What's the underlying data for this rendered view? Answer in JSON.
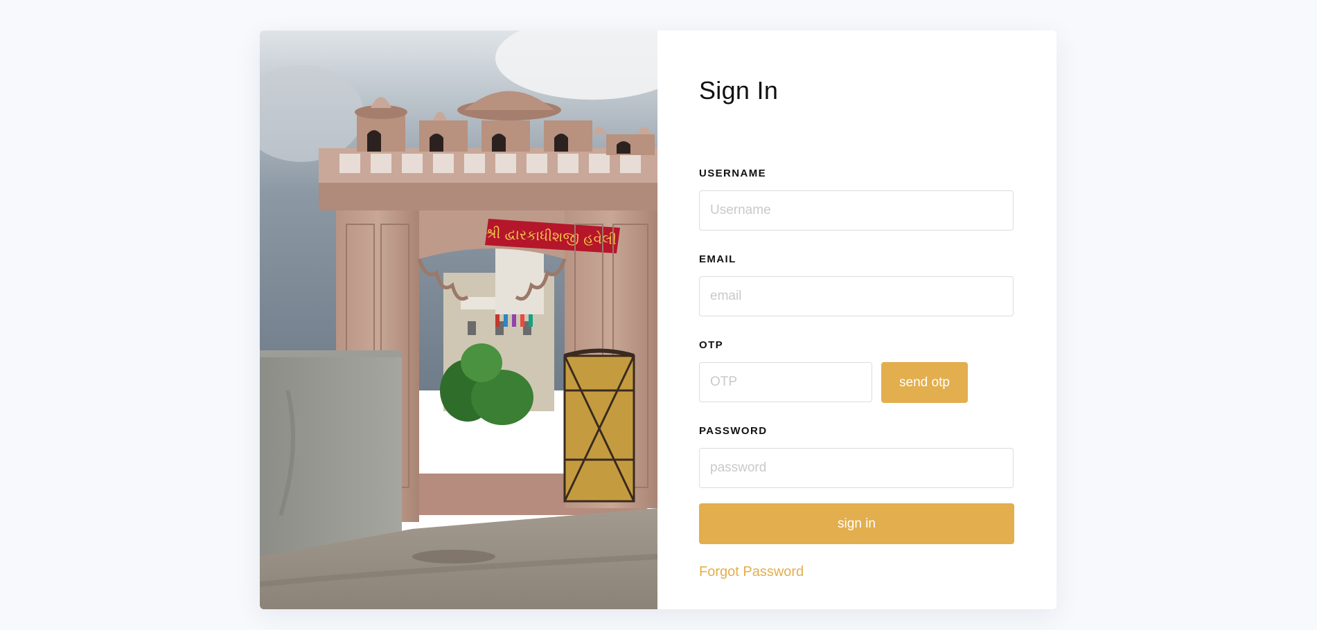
{
  "photo": {
    "description_icon": "haveli-gate-image",
    "sign_text": "શ્રી દ્વારકાધીશજી હવેલી"
  },
  "form": {
    "title": "Sign In",
    "username": {
      "label": "USERNAME",
      "placeholder": "Username",
      "value": ""
    },
    "email": {
      "label": "EMAIL",
      "placeholder": "email",
      "value": ""
    },
    "otp": {
      "label": "OTP",
      "placeholder": "OTP",
      "value": ""
    },
    "send_otp_label": "send otp",
    "password": {
      "label": "PASSWORD",
      "placeholder": "password",
      "value": ""
    },
    "sign_in_label": "sign in",
    "forgot_label": "Forgot Password"
  },
  "colors": {
    "accent": "#e3ae4d",
    "background": "#f7f9fc",
    "card": "#ffffff"
  }
}
